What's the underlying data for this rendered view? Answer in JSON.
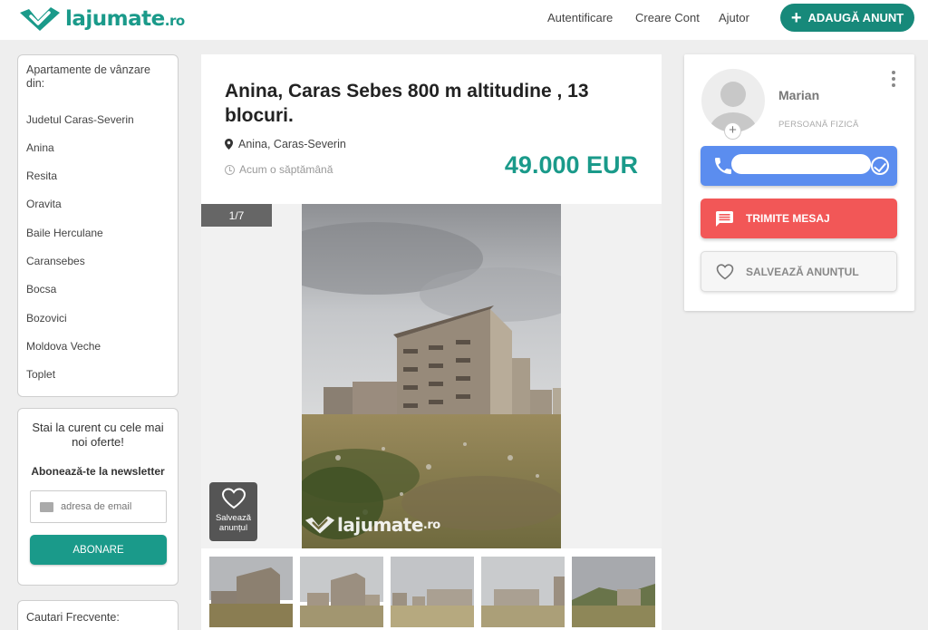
{
  "header": {
    "logo_text": "lajumate",
    "logo_tld": ".ro",
    "nav": [
      "Autentificare",
      "Creare Cont",
      "Ajutor"
    ],
    "add_button": "ADAUGĂ ANUNȚ"
  },
  "sidebar": {
    "locations_title": "Apartamente de vânzare din:",
    "locations": [
      "Judetul Caras-Severin",
      "Anina",
      "Resita",
      "Oravita",
      "Baile Herculane",
      "Caransebes",
      "Bocsa",
      "Bozovici",
      "Moldova Veche",
      "Toplet"
    ],
    "newsletter": {
      "text": "Stai la curent cu cele mai noi oferte!",
      "subtitle": "Abonează-te la newsletter",
      "email_placeholder": "adresa de email",
      "button": "ABONARE"
    },
    "frequent_title": "Cautari Frecvente:"
  },
  "listing": {
    "title": "Anina, Caras Sebes 800 m altitudine , 13 blocuri.",
    "location": "Anina, Caras-Severin",
    "time": "Acum o săptămână",
    "price": "49.000 EUR",
    "gallery": {
      "counter": "1/7",
      "save_label": "Salvează anunțul",
      "thumbnails": 5
    }
  },
  "seller": {
    "name": "Marian",
    "type": "PERSOANĂ FIZICĂ",
    "message_button": "TRIMITE MESAJ",
    "save_button": "SALVEAZĂ ANUNȚUL"
  },
  "colors": {
    "brand": "#1a9a8a",
    "phone_button": "#5b8def",
    "message_button": "#f25757"
  }
}
